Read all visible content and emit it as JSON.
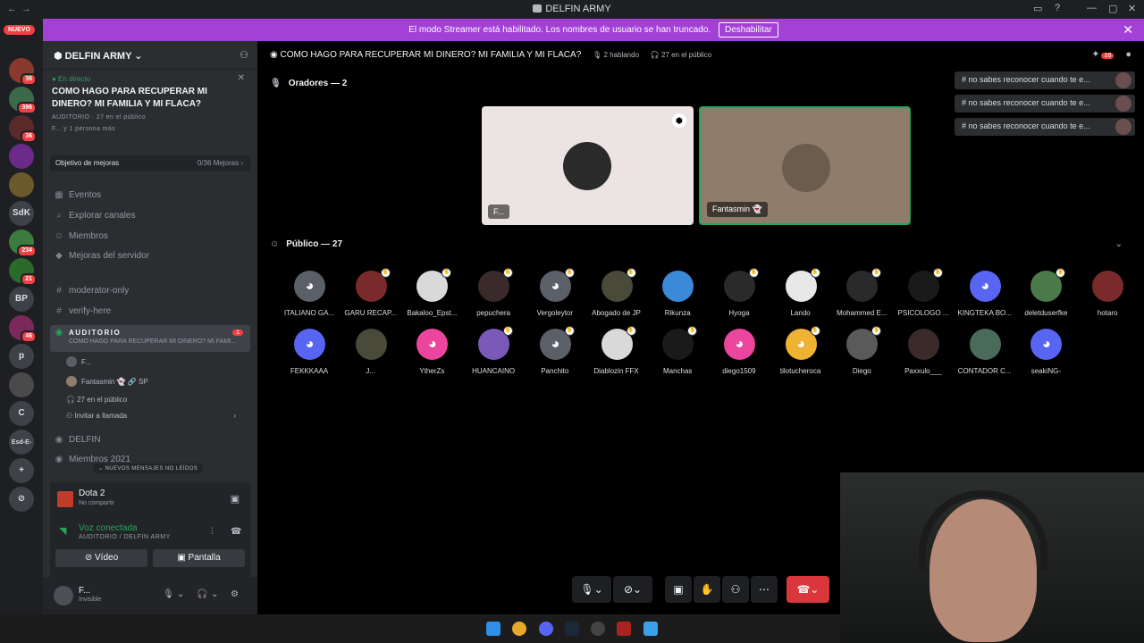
{
  "window": {
    "title": "DELFIN ARMY",
    "back": "←",
    "forward": "→"
  },
  "banner": {
    "text": "El modo Streamer está habilitado. Los nombres de usuario se han truncado.",
    "button": "Deshabilitar",
    "close": "✕"
  },
  "rail": {
    "new_badge": "NUEVO",
    "servers": [
      {
        "label": "",
        "badge": "36",
        "color": "#8a3a2c"
      },
      {
        "label": "",
        "badge": "396",
        "color": "#3b6a4a"
      },
      {
        "label": "",
        "badge": "36",
        "color": "#5a2a2a"
      },
      {
        "label": "",
        "badge": "",
        "color": "#6a2a8a"
      },
      {
        "label": "",
        "badge": "",
        "color": "#6a5a2a"
      },
      {
        "label": "SdK",
        "badge": "",
        "color": "#3f4147"
      },
      {
        "label": "",
        "badge": "234",
        "color": "#3d7a3d"
      },
      {
        "label": "",
        "badge": "21",
        "color": "#2a6a2a"
      },
      {
        "label": "BP",
        "badge": "",
        "color": "#3f4147"
      },
      {
        "label": "",
        "badge": "46",
        "color": "#7a2a5a"
      },
      {
        "label": "p",
        "badge": "",
        "color": "#3f4147"
      },
      {
        "label": "",
        "badge": "",
        "color": "#4a4a4a"
      },
      {
        "label": "C",
        "badge": "",
        "color": "#3f4147"
      },
      {
        "label": "Esd-E-",
        "badge": "",
        "color": "#3f4147"
      },
      {
        "label": "+",
        "badge": "",
        "color": "#3f4147"
      },
      {
        "label": "⊘",
        "badge": "",
        "color": "#3f4147"
      }
    ]
  },
  "sidebar": {
    "server_name": "DELFIN ARMY",
    "live": {
      "tag": "● En directo",
      "title": "COMO HAGO PARA RECUPERAR MI DINERO? MI FAMILIA Y MI FLACA?",
      "meta": "AUDITORIO · 27 en el público",
      "listeners": "F... y 1 persona más"
    },
    "boost": {
      "label": "Objetivo de mejoras",
      "value": "0/36 Mejoras ›"
    },
    "nav": [
      {
        "icon": "▦",
        "label": "Eventos"
      },
      {
        "icon": "⌕",
        "label": "Explorar canales"
      },
      {
        "icon": "☺",
        "label": "Miembros"
      },
      {
        "icon": "◆",
        "label": "Mejoras del servidor"
      }
    ],
    "channels": [
      {
        "icon": "#",
        "label": "moderator-only"
      },
      {
        "icon": "#",
        "label": "verify-here"
      }
    ],
    "stage_channel": {
      "label": "AUDITORIO",
      "sub": "COMO HAGO PARA RECUPERAR MI DINERO? MI FAMI...",
      "count": "1"
    },
    "voice_users": [
      "F...",
      "Fantasmin 👻  🔗 SP"
    ],
    "audience_count": "27 en el público",
    "invite": "Invitar a llamada",
    "more_channels": [
      {
        "icon": "◉",
        "label": "DELFIN"
      },
      {
        "icon": "◉",
        "label": "Miembros 2021"
      }
    ],
    "new_messages": "NUEVOS MENSAJES NO LEÍDOS"
  },
  "activity": {
    "game": "Dota 2",
    "state": "No compartir"
  },
  "voice": {
    "status": "Voz conectada",
    "location": "AUDITORIO / DELFIN ARMY",
    "video_label": "Vídeo",
    "screen_label": "Pantalla"
  },
  "user": {
    "name": "F...",
    "status": "Invisible"
  },
  "stage": {
    "title": "COMO HAGO PARA RECUPERAR MI DINERO? MI FAMILIA Y MI FLACA?",
    "speaking": "2 hablando",
    "audience": "27 en el público",
    "speakers_label": "Oradores — 2",
    "speakers": [
      {
        "name": "F...",
        "bg": "#ebe4e3"
      },
      {
        "name": "Fantasmin 👻",
        "bg": "#8f7d6b"
      }
    ],
    "audience_label": "Público — 27",
    "audience_list": [
      {
        "name": "ITALIANO GA...",
        "color": "#5b6068",
        "hand": false,
        "discord": true
      },
      {
        "name": "GARU RECAP...",
        "color": "#7a2a2a",
        "hand": true,
        "discord": false
      },
      {
        "name": "Bakaloo_Epst...",
        "color": "#d9d9d9",
        "hand": true,
        "discord": false
      },
      {
        "name": "pepuchera",
        "color": "#3a2a2a",
        "hand": true,
        "discord": false
      },
      {
        "name": "Vergoleytor",
        "color": "#5b6068",
        "hand": true,
        "discord": true
      },
      {
        "name": "Abogado de JP",
        "color": "#4a4a3a",
        "hand": true,
        "discord": false
      },
      {
        "name": "Rikunza",
        "color": "#3a8ad8",
        "hand": false,
        "discord": false
      },
      {
        "name": "Hyoga",
        "color": "#2a2a2a",
        "hand": true,
        "discord": false
      },
      {
        "name": "Lando",
        "color": "#e8e8e8",
        "hand": true,
        "discord": false
      },
      {
        "name": "Mohammed E...",
        "color": "#2a2a2a",
        "hand": true,
        "discord": false
      },
      {
        "name": "PSICOLOGO ...",
        "color": "#1a1a1a",
        "hand": true,
        "discord": false
      },
      {
        "name": "KINGTEKA BO...",
        "color": "#5865f2",
        "hand": false,
        "discord": true
      },
      {
        "name": "deletduserfke",
        "color": "#4a7a4a",
        "hand": true,
        "discord": false
      },
      {
        "name": "hotaro",
        "color": "#7a2a2a",
        "hand": false,
        "discord": false
      },
      {
        "name": "FEKKKAAA",
        "color": "#5865f2",
        "hand": false,
        "discord": true
      },
      {
        "name": "J...",
        "color": "#4a4a3a",
        "hand": false,
        "discord": false
      },
      {
        "name": "YtherZs",
        "color": "#eb459e",
        "hand": false,
        "discord": true
      },
      {
        "name": "HUANCAINO",
        "color": "#7a5ab8",
        "hand": true,
        "discord": false
      },
      {
        "name": "Panchito",
        "color": "#5b6068",
        "hand": true,
        "discord": true
      },
      {
        "name": "Diablozin FFX",
        "color": "#d9d9d9",
        "hand": true,
        "discord": false
      },
      {
        "name": "Manchas",
        "color": "#1a1a1a",
        "hand": true,
        "discord": false
      },
      {
        "name": "diego1509",
        "color": "#eb459e",
        "hand": false,
        "discord": true
      },
      {
        "name": "tilotucheroca",
        "color": "#f0b232",
        "hand": true,
        "discord": true
      },
      {
        "name": "Diego",
        "color": "#5a5a5a",
        "hand": true,
        "discord": false
      },
      {
        "name": "Paxxulo___",
        "color": "#3a2a2a",
        "hand": false,
        "discord": false
      },
      {
        "name": "CONTADOR C...",
        "color": "#4a6a5a",
        "hand": false,
        "discord": false
      },
      {
        "name": "seakiNG-",
        "color": "#5865f2",
        "hand": false,
        "discord": true
      }
    ],
    "notifications": [
      "# no sabes reconocer cuando te e...",
      "# no sabes reconocer cuando te e...",
      "# no sabes reconocer cuando te e..."
    ],
    "header_badge": "16"
  },
  "colors": {
    "accent": "#5865f2",
    "danger": "#da373c",
    "online": "#23a55a",
    "banner": "#a341d6"
  }
}
